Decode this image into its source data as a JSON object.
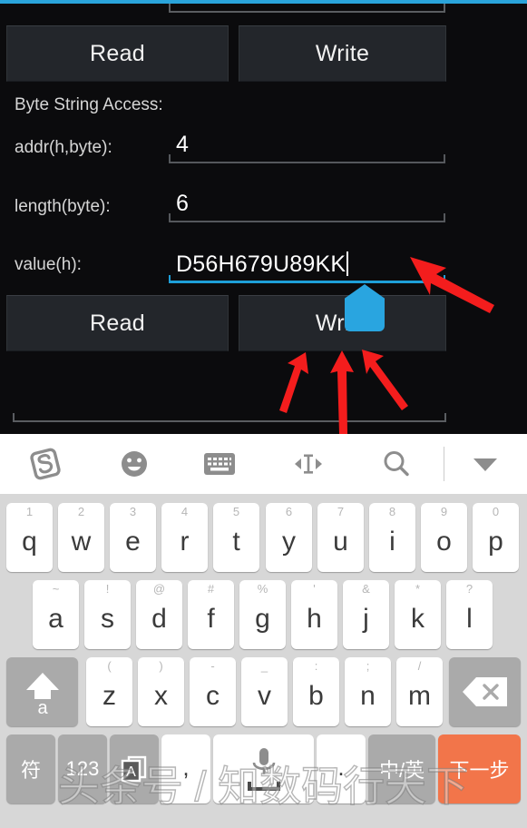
{
  "app": {
    "accent_color": "#2aa4db",
    "section_label": "Byte String Access:",
    "buttons_top": {
      "read": "Read",
      "write": "Write"
    },
    "buttons_bottom": {
      "read": "Read",
      "write": "Write"
    },
    "fields": [
      {
        "label": "addr(h,byte):",
        "value": "4",
        "focused": false
      },
      {
        "label": "length(byte):",
        "value": "6",
        "focused": false
      },
      {
        "label": "value(h):",
        "value": "D56H679U89KK",
        "focused": true
      }
    ],
    "annotation": {
      "arrow_color": "#f41d1d",
      "handle_color": "#29a5e0",
      "arrow_count": 4
    }
  },
  "keyboard": {
    "background_color": "#d7d7d7",
    "toolbar": [
      {
        "name": "sogou-logo-icon",
        "glyph": "S"
      },
      {
        "name": "emoji-icon",
        "glyph": "emoji"
      },
      {
        "name": "keyboard-icon",
        "glyph": "keyboard"
      },
      {
        "name": "cursor-move-icon",
        "glyph": "cursor"
      },
      {
        "name": "search-icon",
        "glyph": "search"
      },
      {
        "name": "collapse-keyboard-icon",
        "glyph": "chevron-down"
      }
    ],
    "row1": [
      {
        "main": "q",
        "sup": "1"
      },
      {
        "main": "w",
        "sup": "2"
      },
      {
        "main": "e",
        "sup": "3"
      },
      {
        "main": "r",
        "sup": "4"
      },
      {
        "main": "t",
        "sup": "5"
      },
      {
        "main": "y",
        "sup": "6"
      },
      {
        "main": "u",
        "sup": "7"
      },
      {
        "main": "i",
        "sup": "8"
      },
      {
        "main": "o",
        "sup": "9"
      },
      {
        "main": "p",
        "sup": "0"
      }
    ],
    "row2": [
      {
        "main": "a",
        "sup": "~"
      },
      {
        "main": "s",
        "sup": "!"
      },
      {
        "main": "d",
        "sup": "@"
      },
      {
        "main": "f",
        "sup": "#"
      },
      {
        "main": "g",
        "sup": "%"
      },
      {
        "main": "h",
        "sup": "'"
      },
      {
        "main": "j",
        "sup": "&"
      },
      {
        "main": "k",
        "sup": "*"
      },
      {
        "main": "l",
        "sup": "?"
      }
    ],
    "row3": [
      {
        "main": "z",
        "sup": "("
      },
      {
        "main": "x",
        "sup": ")"
      },
      {
        "main": "c",
        "sup": "-"
      },
      {
        "main": "v",
        "sup": "_"
      },
      {
        "main": "b",
        "sup": ":"
      },
      {
        "main": "n",
        "sup": ";"
      },
      {
        "main": "m",
        "sup": "/"
      }
    ],
    "shift_key": {
      "name": "shift-key",
      "label": "a"
    },
    "backspace_key": {
      "name": "backspace-key",
      "label": "✕"
    },
    "row4": {
      "symbol": "符",
      "numbers": "123",
      "translate": "A",
      "comma": ",",
      "space": "",
      "period": ".",
      "lang_toggle": "中/英",
      "enter": "下一步",
      "enter_color": "#f2754a"
    }
  },
  "watermark": {
    "text": "头条号 / 知数码行天下"
  }
}
